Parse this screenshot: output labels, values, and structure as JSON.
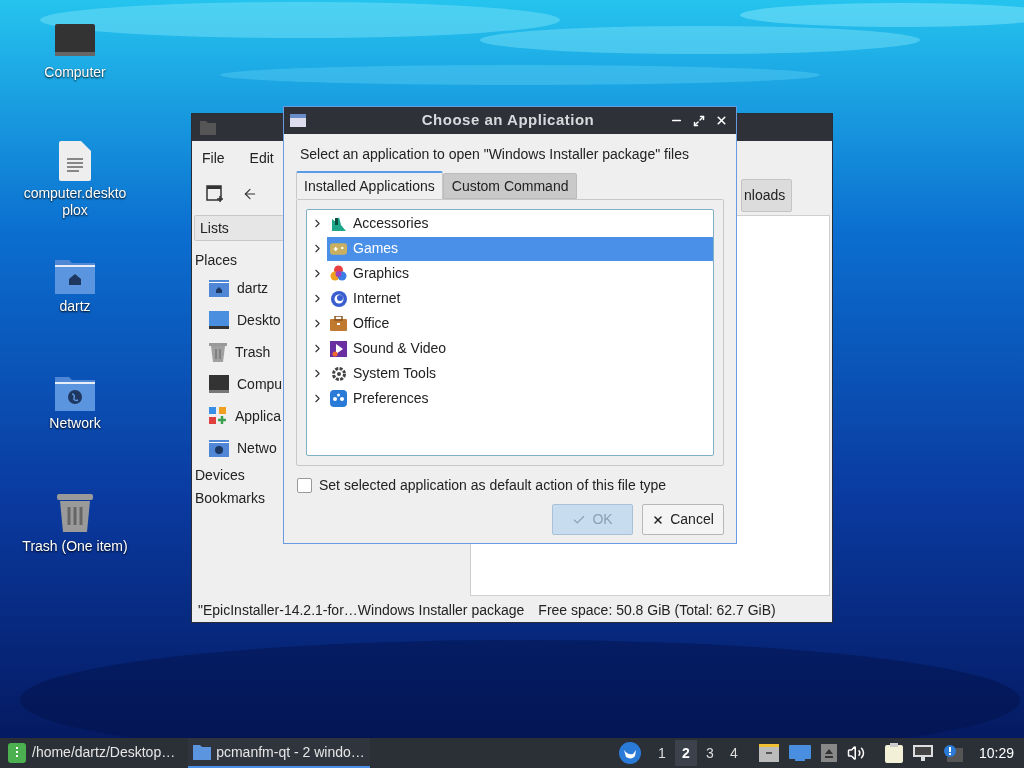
{
  "desktop_icons": [
    {
      "label": "Computer",
      "kind": "computer"
    },
    {
      "label": "computer.deskto plox",
      "kind": "file"
    },
    {
      "label": "dartz",
      "kind": "home"
    },
    {
      "label": "Network",
      "kind": "network"
    },
    {
      "label": "Trash (One item)",
      "kind": "trash"
    }
  ],
  "file_manager": {
    "menu": [
      "File",
      "Edit"
    ],
    "location_button": "nloads",
    "view_selector": "Lists",
    "sidebar": [
      {
        "title": "Places",
        "items": [
          {
            "label": "dartz",
            "kind": "home"
          },
          {
            "label": "Deskto",
            "kind": "desktop"
          },
          {
            "label": "Trash",
            "kind": "trash"
          },
          {
            "label": "Compu",
            "kind": "computer"
          },
          {
            "label": "Applica",
            "kind": "apps"
          },
          {
            "label": "Netwo",
            "kind": "network"
          }
        ]
      },
      {
        "title": "Devices"
      },
      {
        "title": "Bookmarks"
      }
    ],
    "status_bar": {
      "file": "\"EpicInstaller-14.2.1-for…Windows Installer package",
      "free_space": "Free space: 50.8 GiB (Total: 62.7 GiB)"
    }
  },
  "dialog": {
    "title": "Choose an Application",
    "prompt": "Select an application to open \"Windows Installer package\" files",
    "tabs": [
      {
        "label": "Installed Applications",
        "selected": true
      },
      {
        "label": "Custom Command",
        "selected": false
      }
    ],
    "categories": [
      {
        "label": "Accessories",
        "kind": "accessories",
        "selected": false,
        "expanded": false
      },
      {
        "label": "Games",
        "kind": "games",
        "selected": true,
        "expanded": false
      },
      {
        "label": "Graphics",
        "kind": "graphics",
        "selected": false,
        "expanded": false
      },
      {
        "label": "Internet",
        "kind": "internet",
        "selected": false,
        "expanded": false
      },
      {
        "label": "Office",
        "kind": "office",
        "selected": false,
        "expanded": false
      },
      {
        "label": "Sound & Video",
        "kind": "sound",
        "selected": false,
        "expanded": false
      },
      {
        "label": "System Tools",
        "kind": "system",
        "selected": false,
        "expanded": false
      },
      {
        "label": "Preferences",
        "kind": "preferences",
        "selected": false,
        "expanded": false
      }
    ],
    "default_checkbox": {
      "label": "Set selected application as default action of this file type",
      "checked": false
    },
    "buttons": [
      {
        "label": "OK",
        "kind": "ok",
        "disabled": true
      },
      {
        "label": "Cancel",
        "kind": "cancel",
        "disabled": false
      }
    ]
  },
  "taskbar": {
    "tasks": [
      {
        "label": "/home/dartz/Desktop…",
        "kind": "terminal",
        "selected": false
      },
      {
        "label": "pcmanfm-qt - 2 windo…",
        "kind": "folder",
        "selected": true
      }
    ],
    "workspaces": [
      {
        "label": "1",
        "selected": false
      },
      {
        "label": "2",
        "selected": true
      },
      {
        "label": "3",
        "selected": false
      },
      {
        "label": "4",
        "selected": false
      }
    ],
    "clock": "10:29"
  }
}
